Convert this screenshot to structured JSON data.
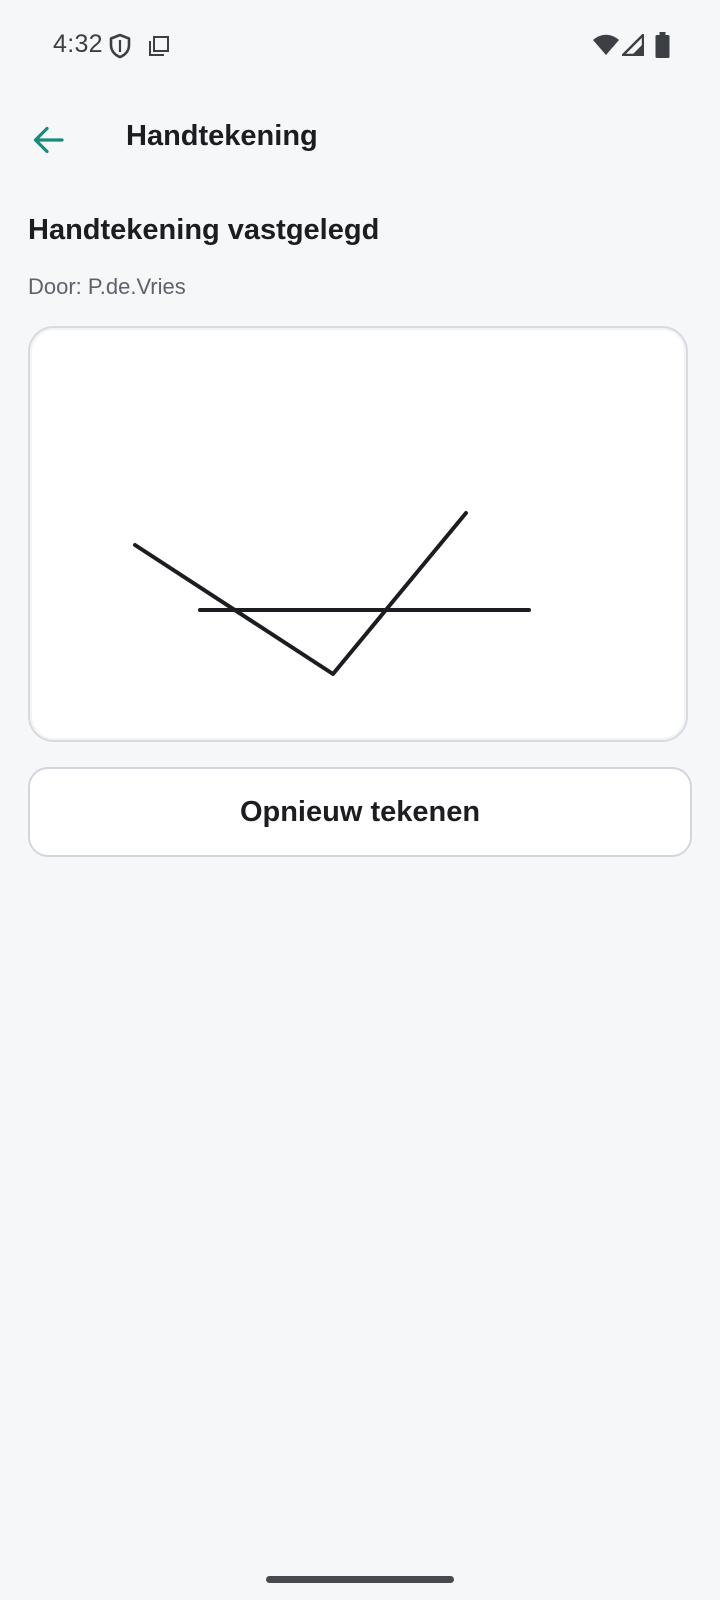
{
  "status_bar": {
    "time": "4:32",
    "left_icons": [
      "shield-icon",
      "screenshot-icon"
    ],
    "right_icons": [
      "wifi-icon",
      "cellular-signal-icon",
      "battery-icon"
    ]
  },
  "app_bar": {
    "back_icon": "arrow-left-icon",
    "title": "Handtekening"
  },
  "content": {
    "heading": "Handtekening vastgelegd",
    "signer": "Door: P.de.Vries",
    "redraw_button": "Opnieuw tekenen"
  },
  "colors": {
    "background": "#f6f7f9",
    "accent": "#1a8a7b",
    "text_primary": "#1b1d21",
    "text_secondary": "#5d636b",
    "signature_stroke": "#1b1d21"
  }
}
